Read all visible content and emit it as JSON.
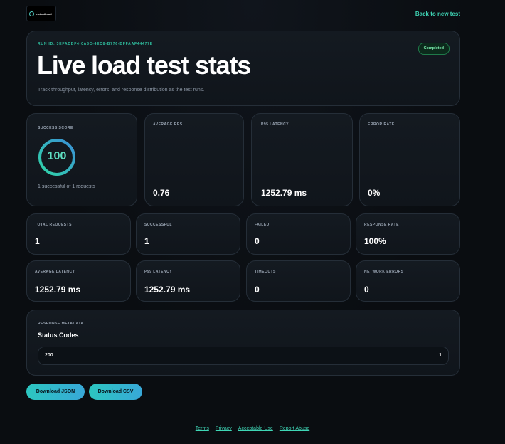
{
  "header": {
    "logo_text": "InstantLoad",
    "back_link": "Back to new test"
  },
  "hero": {
    "run_id": "RUN ID: 3EFADBF4-0A8C-4EC8-B776-BFFAAF44477E",
    "title": "Live load test stats",
    "subtitle": "Track throughput, latency, errors, and response distribution as the test runs.",
    "status_badge": "Completed"
  },
  "score": {
    "label": "SUCCESS SCORE",
    "value": "100",
    "percent": 100,
    "subtext": "1 successful of 1 requests"
  },
  "top_stats": [
    {
      "label": "AVERAGE RPS",
      "value": "0.76"
    },
    {
      "label": "P95 LATENCY",
      "value": "1252.79 ms"
    },
    {
      "label": "ERROR RATE",
      "value": "0%"
    }
  ],
  "row1_stats": [
    {
      "label": "TOTAL REQUESTS",
      "value": "1"
    },
    {
      "label": "SUCCESSFUL",
      "value": "1"
    },
    {
      "label": "FAILED",
      "value": "0"
    },
    {
      "label": "RESPONSE RATE",
      "value": "100%"
    }
  ],
  "row2_stats": [
    {
      "label": "AVERAGE LATENCY",
      "value": "1252.79 ms"
    },
    {
      "label": "P99 LATENCY",
      "value": "1252.79 ms"
    },
    {
      "label": "TIMEOUTS",
      "value": "0"
    },
    {
      "label": "NETWORK ERRORS",
      "value": "0"
    }
  ],
  "metadata": {
    "label": "RESPONSE METADATA",
    "title": "Status Codes",
    "codes": [
      {
        "code": "200",
        "count": "1"
      }
    ]
  },
  "actions": {
    "download_json": "Download JSON",
    "download_csv": "Download CSV"
  },
  "footer": {
    "links": [
      "Terms",
      "Privacy",
      "Acceptable Use",
      "Report Abuse"
    ]
  },
  "colors": {
    "accent": "#3fd6b6",
    "gauge": "#5fe0c2",
    "badge_text": "#7df0b0"
  }
}
